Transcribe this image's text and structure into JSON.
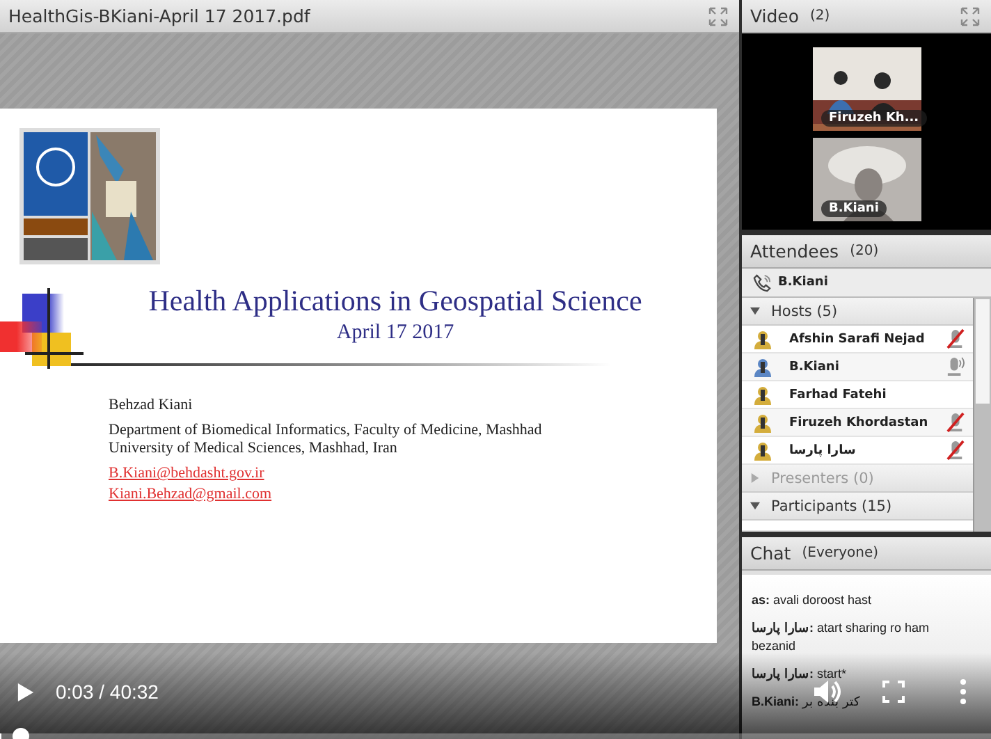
{
  "document": {
    "title": "HealthGis-BKiani-April 17 2017.pdf",
    "slide": {
      "title": "Health Applications in Geospatial Science",
      "date": "April 17 2017",
      "author": "Behzad Kiani",
      "affiliation": [
        "Department of Biomedical Informatics, Faculty of Medicine, Mashhad",
        "University of Medical Sciences, Mashhad, Iran"
      ],
      "links": [
        "B.Kiani@behdasht.gov.ir",
        "Kiani.Behzad@gmail.com"
      ]
    }
  },
  "video": {
    "title": "Video",
    "count": "(2)",
    "tiles": [
      {
        "name": "Firuzeh Kh..."
      },
      {
        "name": "B.Kiani"
      }
    ]
  },
  "attendees": {
    "title": "Attendees",
    "count": "(20)",
    "me": "B.Kiani",
    "groups": [
      {
        "label": "Hosts (5)",
        "expanded": true,
        "disabled": false,
        "members": [
          {
            "name": "Afshin Sarafi Nejad",
            "color": "#d4ad3c",
            "muted": true,
            "speaking": false
          },
          {
            "name": "B.Kiani",
            "color": "#5b86c4",
            "muted": false,
            "speaking": true
          },
          {
            "name": "Farhad Fatehi",
            "color": "#d4ad3c",
            "muted": false,
            "speaking": false
          },
          {
            "name": "Firuzeh Khordastan",
            "color": "#d4ad3c",
            "muted": true,
            "speaking": false
          },
          {
            "name": "سارا پارسا",
            "color": "#d4ad3c",
            "muted": true,
            "speaking": false
          }
        ]
      },
      {
        "label": "Presenters (0)",
        "expanded": false,
        "disabled": true
      },
      {
        "label": "Participants (15)",
        "expanded": true,
        "disabled": false
      }
    ]
  },
  "chat": {
    "title": "Chat",
    "scope": "(Everyone)",
    "messages": [
      {
        "text": "**as:** avali doroost hast"
      },
      {
        "text": "**سارا پارسا:** atart sharing ro ham bezanid"
      },
      {
        "text": "**سارا پارسا:** start*"
      },
      {
        "text": "**B.Kiani:** کتر بنده بر"
      }
    ]
  },
  "player": {
    "time": "0:03 / 40:32",
    "level": 0.002
  }
}
